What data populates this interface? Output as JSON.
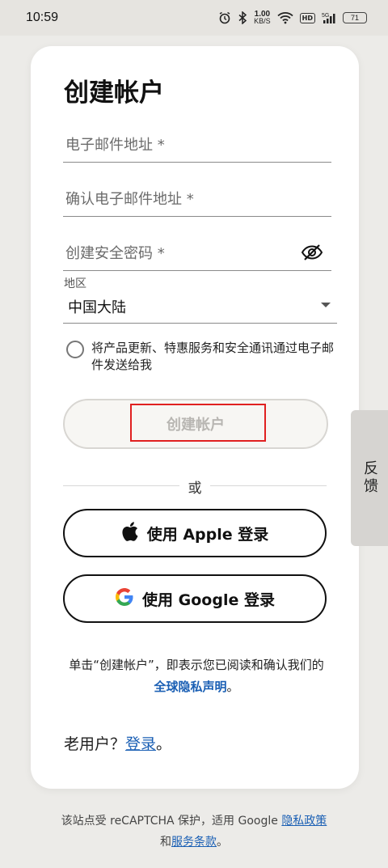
{
  "status_bar": {
    "time": "10:59",
    "net_speed_value": "1.00",
    "net_speed_unit": "KB/S",
    "hd_label": "HD",
    "signal_label": "5G",
    "battery": "71"
  },
  "form": {
    "title": "创建帐户",
    "email_placeholder": "电子邮件地址 *",
    "confirm_email_placeholder": "确认电子邮件地址 *",
    "password_placeholder": "创建安全密码 *",
    "region_label": "地区",
    "region_value": "中国大陆",
    "consent_text": "将产品更新、特惠服务和安全通讯通过电子邮件发送给我",
    "create_button_label": "创建帐户",
    "or_text": "或",
    "apple_button_label": "使用 Apple 登录",
    "google_button_label": "使用 Google 登录",
    "legal_text_before": "单击“创建帐户”，即表示您已阅读和确认我们的",
    "legal_link": "全球隐私声明",
    "legal_text_after": "。",
    "old_user_text": "老用户？",
    "login_link": "登录",
    "old_user_suffix": "。"
  },
  "feedback_tab": {
    "label": "反馈"
  },
  "footer": {
    "text_before": "该站点受 reCAPTCHA 保护，适用 Google ",
    "privacy_link": "隐私政策",
    "and_text": "和",
    "terms_link": "服务条款",
    "end_text": "。"
  },
  "colors": {
    "link": "#1a5fb4",
    "highlight": "#e02020",
    "background": "#ecebe8"
  }
}
